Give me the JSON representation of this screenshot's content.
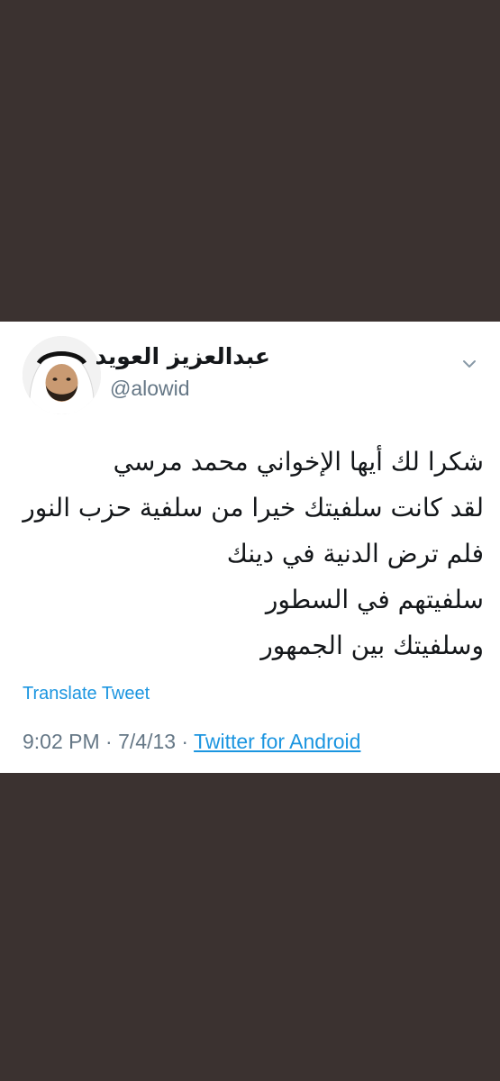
{
  "tweet": {
    "display_name": "عبدالعزيز العويد",
    "handle": "@alowid",
    "text_lines": [
      "شكرا لك أيها الإخواني محمد مرسي",
      "لقد كانت سلفيتك خيرا من سلفية حزب النور",
      "فلم ترض الدنية في دينك",
      "سلفيتهم في السطور",
      "وسلفيتك بين الجمهور"
    ],
    "translate_label": "Translate Tweet",
    "timestamp": "9:02 PM · 7/4/13 · ",
    "source": "Twitter for Android",
    "menu_icon": "chevron-down-icon"
  },
  "colors": {
    "background": "#3b3230",
    "card": "#ffffff",
    "link": "#1b95e0",
    "secondary_text": "#657786",
    "primary_text": "#14171a"
  }
}
